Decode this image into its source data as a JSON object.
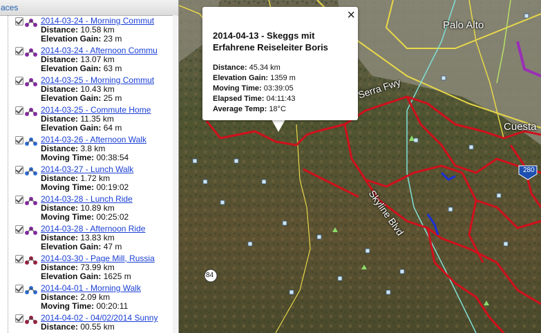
{
  "sidebar": {
    "header_title": "aces",
    "entries": [
      {
        "title": "2014-03-24 - Morning Commut",
        "icon_color": "purple",
        "stat1_label": "Distance:",
        "stat1_value": "10.58 km",
        "stat2_label": "Elevation Gain:",
        "stat2_value": "23 m"
      },
      {
        "title": "2014-03-24 - Afternoon Commu",
        "icon_color": "purple",
        "stat1_label": "Distance:",
        "stat1_value": "13.07 km",
        "stat2_label": "Elevation Gain:",
        "stat2_value": "63 m"
      },
      {
        "title": "2014-03-25 - Morning Commut",
        "icon_color": "purple",
        "stat1_label": "Distance:",
        "stat1_value": "10.43 km",
        "stat2_label": "Elevation Gain:",
        "stat2_value": "25 m"
      },
      {
        "title": "2014-03-25 - Commute Home",
        "icon_color": "purple",
        "stat1_label": "Distance:",
        "stat1_value": "11.35 km",
        "stat2_label": "Elevation Gain:",
        "stat2_value": "64 m"
      },
      {
        "title": "2014-03-26 - Afternoon Walk",
        "icon_color": "blue",
        "stat1_label": "Distance:",
        "stat1_value": "3.8 km",
        "stat2_label": "Moving Time:",
        "stat2_value": "00:38:54"
      },
      {
        "title": "2014-03-27 - Lunch Walk",
        "icon_color": "blue",
        "stat1_label": "Distance:",
        "stat1_value": "1.72 km",
        "stat2_label": "Moving Time:",
        "stat2_value": "00:19:02"
      },
      {
        "title": "2014-03-28 - Lunch Ride",
        "icon_color": "purple",
        "stat1_label": "Distance:",
        "stat1_value": "10.89 km",
        "stat2_label": "Moving Time:",
        "stat2_value": "00:25:02"
      },
      {
        "title": "2014-03-28 - Afternoon Ride",
        "icon_color": "purple",
        "stat1_label": "Distance:",
        "stat1_value": "13.83 km",
        "stat2_label": "Elevation Gain:",
        "stat2_value": "47 m"
      },
      {
        "title": "2014-03-30 - Page Mill, Russia",
        "icon_color": "red",
        "stat1_label": "Distance:",
        "stat1_value": "73.99 km",
        "stat2_label": "Elevation Gain:",
        "stat2_value": "1625 m"
      },
      {
        "title": "2014-04-01 - Morning Walk",
        "icon_color": "blue",
        "stat1_label": "Distance:",
        "stat1_value": "2.09 km",
        "stat2_label": "Moving Time:",
        "stat2_value": "00:20:11"
      },
      {
        "title": "2014-04-02 - 04/02/2014 Sunny",
        "icon_color": "red",
        "stat1_label": "Distance:",
        "stat1_value": "00.55 km",
        "stat2_label": "",
        "stat2_value": ""
      }
    ]
  },
  "map": {
    "labels": {
      "palo_alto": "Palo Alto",
      "cuesta": "Cuesta",
      "serra_fwy": "Serra Fwy",
      "skyline_blvd": "Skyline Blvd",
      "hwy_280": "280",
      "hwy_84": "84"
    },
    "colors": {
      "track_red": "#d0101c",
      "road_yellow": "#e8d84a",
      "trail_cyan": "#7fe0d8",
      "route_purple": "#9a2fb5"
    }
  },
  "popup": {
    "title": "2014-04-13 - Skeggs mit Erfahrene Reiseleiter Boris",
    "close_symbol": "×",
    "stats": [
      {
        "label": "Distance:",
        "value": "45.34 km"
      },
      {
        "label": "Elevation Gain:",
        "value": "1359 m"
      },
      {
        "label": "Moving Time:",
        "value": "03:39:05"
      },
      {
        "label": "Elapsed Time:",
        "value": "04:11:43"
      },
      {
        "label": "Average Temp:",
        "value": "18°C"
      }
    ]
  }
}
